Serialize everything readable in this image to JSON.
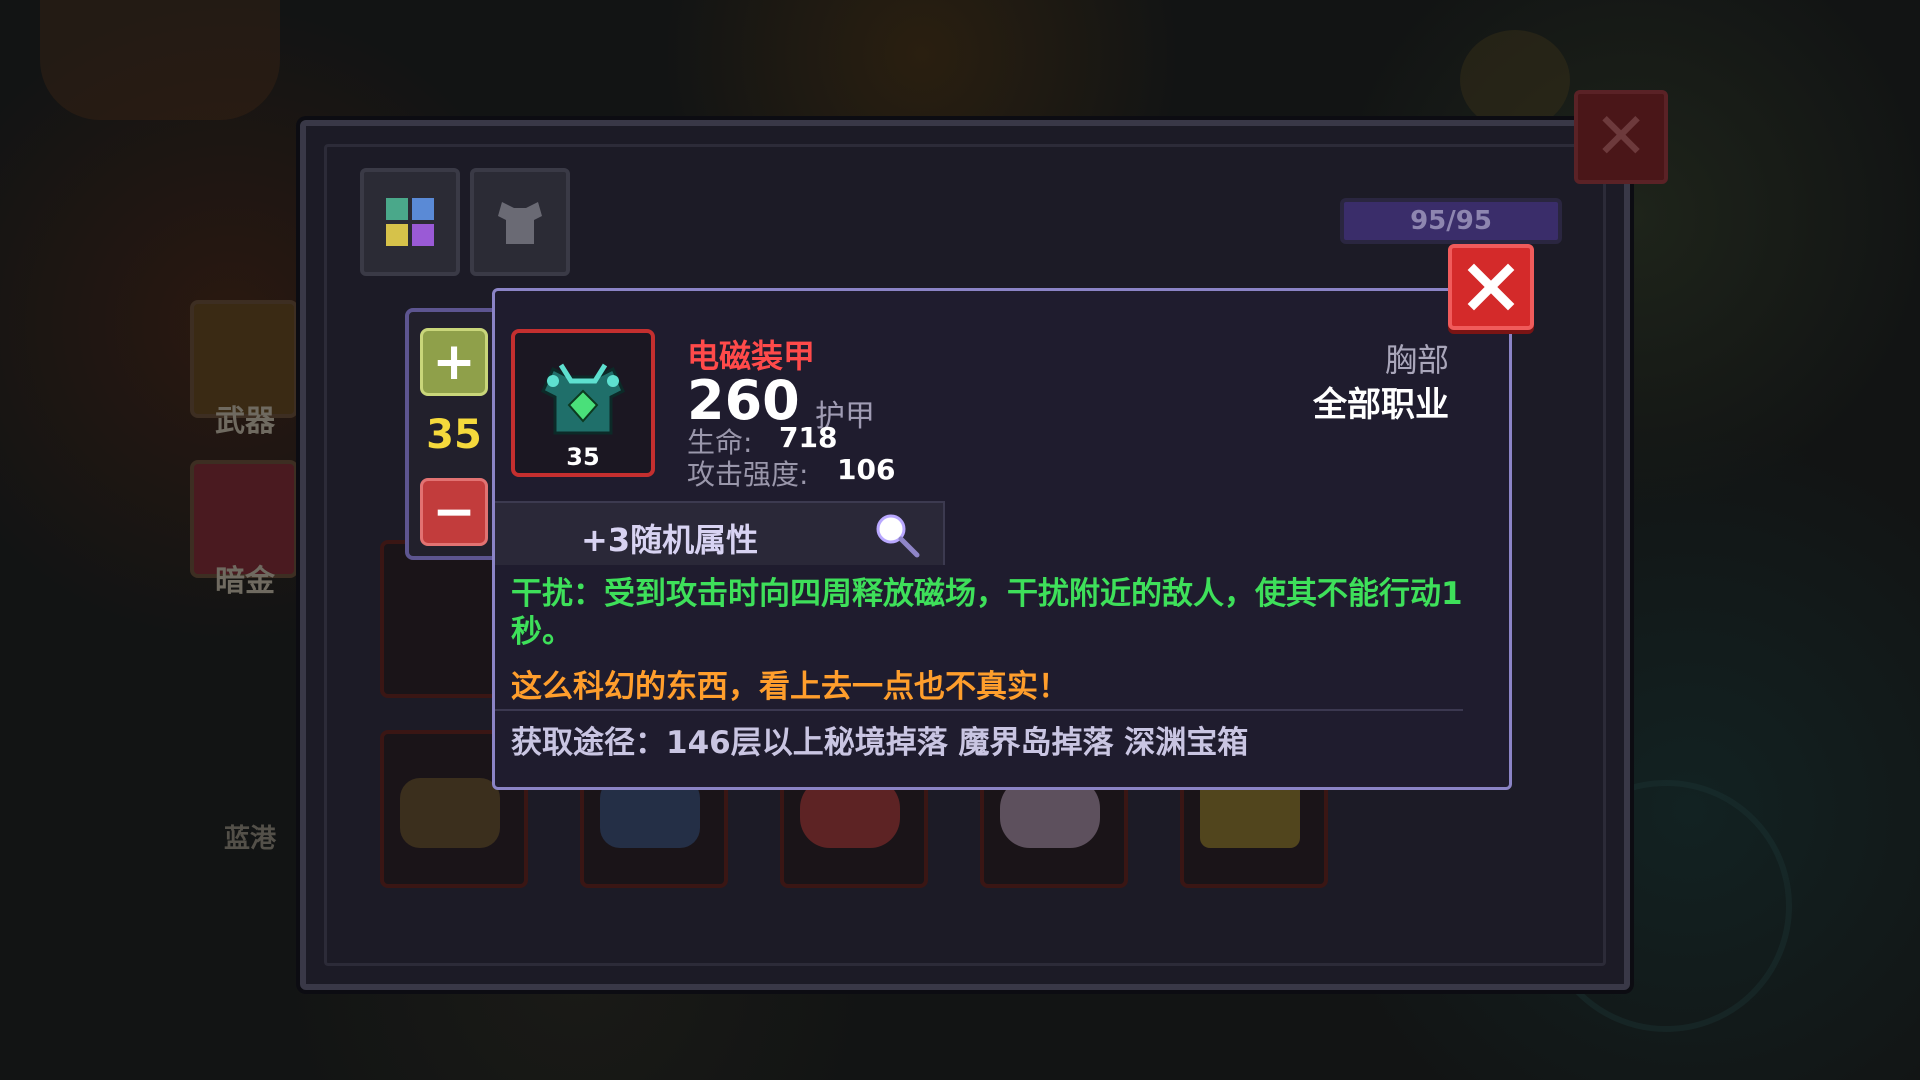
{
  "inventory": {
    "capacity": "95/95"
  },
  "side_menu": {
    "weapon_label": "武器",
    "darkgold_label": "暗金",
    "bottom_label": "蓝港"
  },
  "level_selector": {
    "level": "35",
    "plus_label": "+",
    "minus_label": "−"
  },
  "item": {
    "name": "电磁装甲",
    "level": "35",
    "armor_value": "260",
    "armor_label": "护甲",
    "stats": [
      {
        "label": "生命:",
        "value": "718"
      },
      {
        "label": "攻击强度:",
        "value": "106"
      }
    ],
    "slot": "胸部",
    "class_restriction": "全部职业",
    "random_affixes": "+3随机属性",
    "effect": "干扰：受到攻击时向四周释放磁场，干扰附近的敌人，使其不能行动1秒。",
    "flavor": "这么科幻的东西，看上去一点也不真实！",
    "source": "获取途径：146层以上秘境掉落 魔界岛掉落 深渊宝箱"
  },
  "colors": {
    "item_name": "#ff4a4a",
    "effect_text": "#3ee05a",
    "flavor_text": "#ff9e2c",
    "level_text": "#f5d93c",
    "tooltip_border": "#8b84c6",
    "close_button": "#d42a2a"
  },
  "icons": {
    "close": "close-icon",
    "magnifier": "magnifier-icon",
    "item": "armor-icon"
  }
}
